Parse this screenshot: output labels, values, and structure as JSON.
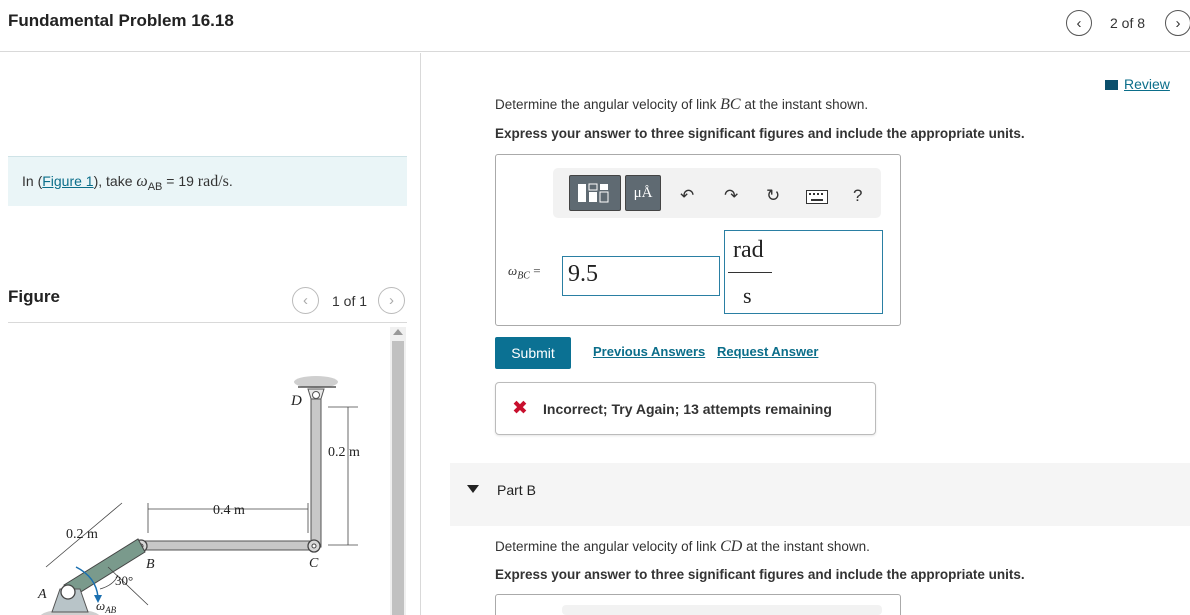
{
  "header": {
    "title": "Fundamental Problem 16.18",
    "pager": "2 of 8"
  },
  "given": {
    "prefix": "In (",
    "figure_link": "Figure 1",
    "suffix": "), take ",
    "symbol": "ω",
    "subscript": "AB",
    "equals": " = 19 ",
    "units": "rad/s",
    "period": "."
  },
  "figure_panel": {
    "label": "Figure",
    "count": "1 of 1",
    "labels": {
      "D": "D",
      "B": "B",
      "C": "C",
      "A": "A",
      "len_bc": "0.4 m",
      "len_cd": "0.2 m",
      "len_ab": "0.2 m",
      "angle": "30°",
      "omega": "ω",
      "omega_sub": "AB"
    }
  },
  "review": "Review",
  "part_a": {
    "question_prefix": "Determine the angular velocity of link ",
    "question_link": "BC",
    "question_suffix": " at the instant shown.",
    "instruction": "Express your answer to three significant figures and include the appropriate units.",
    "toolbar": {
      "mu_label": "μÅ",
      "help_label": "?"
    },
    "variable_symbol": "ω",
    "variable_sub": "BC",
    "variable_eq": " =",
    "value": "9.5",
    "unit_numerator": "rad",
    "unit_denominator": "s",
    "submit_label": "Submit",
    "previous_answers": "Previous Answers",
    "request_answer": "Request Answer",
    "feedback_icon": "✖",
    "feedback": "Incorrect; Try Again; 13 attempts remaining"
  },
  "part_b": {
    "label": "Part B",
    "question_prefix": "Determine the angular velocity of link ",
    "question_link": "CD",
    "question_suffix": " at the instant shown.",
    "instruction": "Express your answer to three significant figures and include the appropriate units."
  },
  "colors": {
    "accent": "#0b7193",
    "link": "#0b6e8a",
    "error": "#c8102e",
    "given_bg": "#eaf5f7"
  }
}
